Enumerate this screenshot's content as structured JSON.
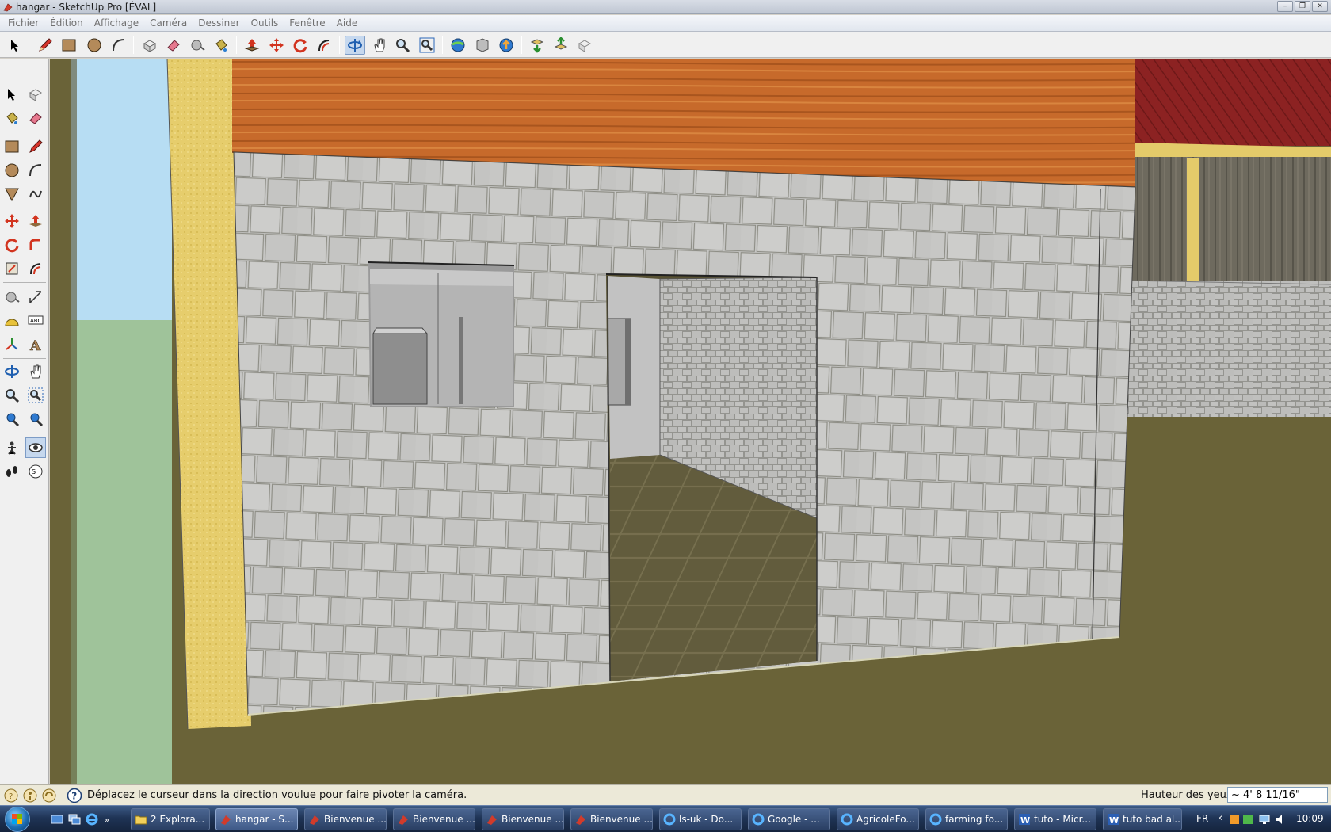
{
  "window": {
    "title": "hangar - SketchUp Pro [ÉVAL]",
    "controls": [
      "minimize",
      "restore",
      "close"
    ]
  },
  "menu": {
    "items": [
      "Fichier",
      "Édition",
      "Affichage",
      "Caméra",
      "Dessiner",
      "Outils",
      "Fenêtre",
      "Aide"
    ]
  },
  "toolbar_top": {
    "tools": [
      "select-arrow-icon",
      "pencil-icon",
      "rectangle-icon",
      "circle-icon",
      "arc-icon",
      "make-component-icon",
      "eraser-icon",
      "tape-measure-icon",
      "paint-bucket-icon",
      "push-pull-icon",
      "move-icon",
      "rotate-icon",
      "offset-icon",
      "orbit-icon",
      "pan-icon",
      "zoom-icon",
      "zoom-extents-icon",
      "get-models-icon",
      "share-model-icon",
      "share-component-icon",
      "google-earth-icon",
      "toggle-terrain-icon",
      "preview-earth-icon"
    ]
  },
  "toolbar_left": {
    "tools": [
      "select-icon",
      "make-component-icon",
      "paint-bucket-icon",
      "eraser-icon",
      "rectangle-icon",
      "line-icon",
      "circle-icon",
      "arc-icon",
      "polygon-icon",
      "freehand-icon",
      "move-icon",
      "push-pull-icon",
      "rotate-icon",
      "follow-me-icon",
      "scale-icon",
      "offset-icon",
      "tape-measure-icon",
      "dimension-icon",
      "protractor-icon",
      "text-icon",
      "axes-icon",
      "3d-text-icon",
      "orbit-icon",
      "pan-icon",
      "zoom-icon",
      "zoom-window-icon",
      "previous-view-icon",
      "next-view-icon",
      "position-camera-icon",
      "look-around-icon",
      "walk-icon",
      "section-plane-icon"
    ]
  },
  "status": {
    "message": "Déplacez le curseur dans la direction voulue pour faire pivoter la caméra.",
    "vcb_label": "Hauteur des yeux",
    "vcb_value": "~ 4' 8 11/16\""
  },
  "taskbar": {
    "buttons": [
      {
        "label": "2 Explora...",
        "icon": "folder-icon"
      },
      {
        "label": "hangar - S...",
        "icon": "sketchup-icon",
        "active": true
      },
      {
        "label": "Bienvenue ...",
        "icon": "sketchup-icon"
      },
      {
        "label": "Bienvenue ...",
        "icon": "sketchup-icon"
      },
      {
        "label": "Bienvenue ...",
        "icon": "sketchup-icon"
      },
      {
        "label": "Bienvenue ...",
        "icon": "sketchup-icon"
      },
      {
        "label": "ls-uk - Do...",
        "icon": "ie-icon"
      },
      {
        "label": "Google - ...",
        "icon": "ie-icon"
      },
      {
        "label": "AgricoleFo...",
        "icon": "ie-icon"
      },
      {
        "label": "farming fo...",
        "icon": "ie-icon"
      },
      {
        "label": "tuto - Micr...",
        "icon": "word-icon"
      },
      {
        "label": "tuto bad al...",
        "icon": "word-icon"
      }
    ],
    "language": "FR",
    "clock": "10:09"
  },
  "colors": {
    "sky": "#b7ddf3",
    "grass": "#9fc39a",
    "ground": "#6a6338",
    "wall": "#c7c7c7",
    "wood": "#c8692a",
    "yellow_beam": "#e4cb6a",
    "roof": "#8f2323"
  }
}
